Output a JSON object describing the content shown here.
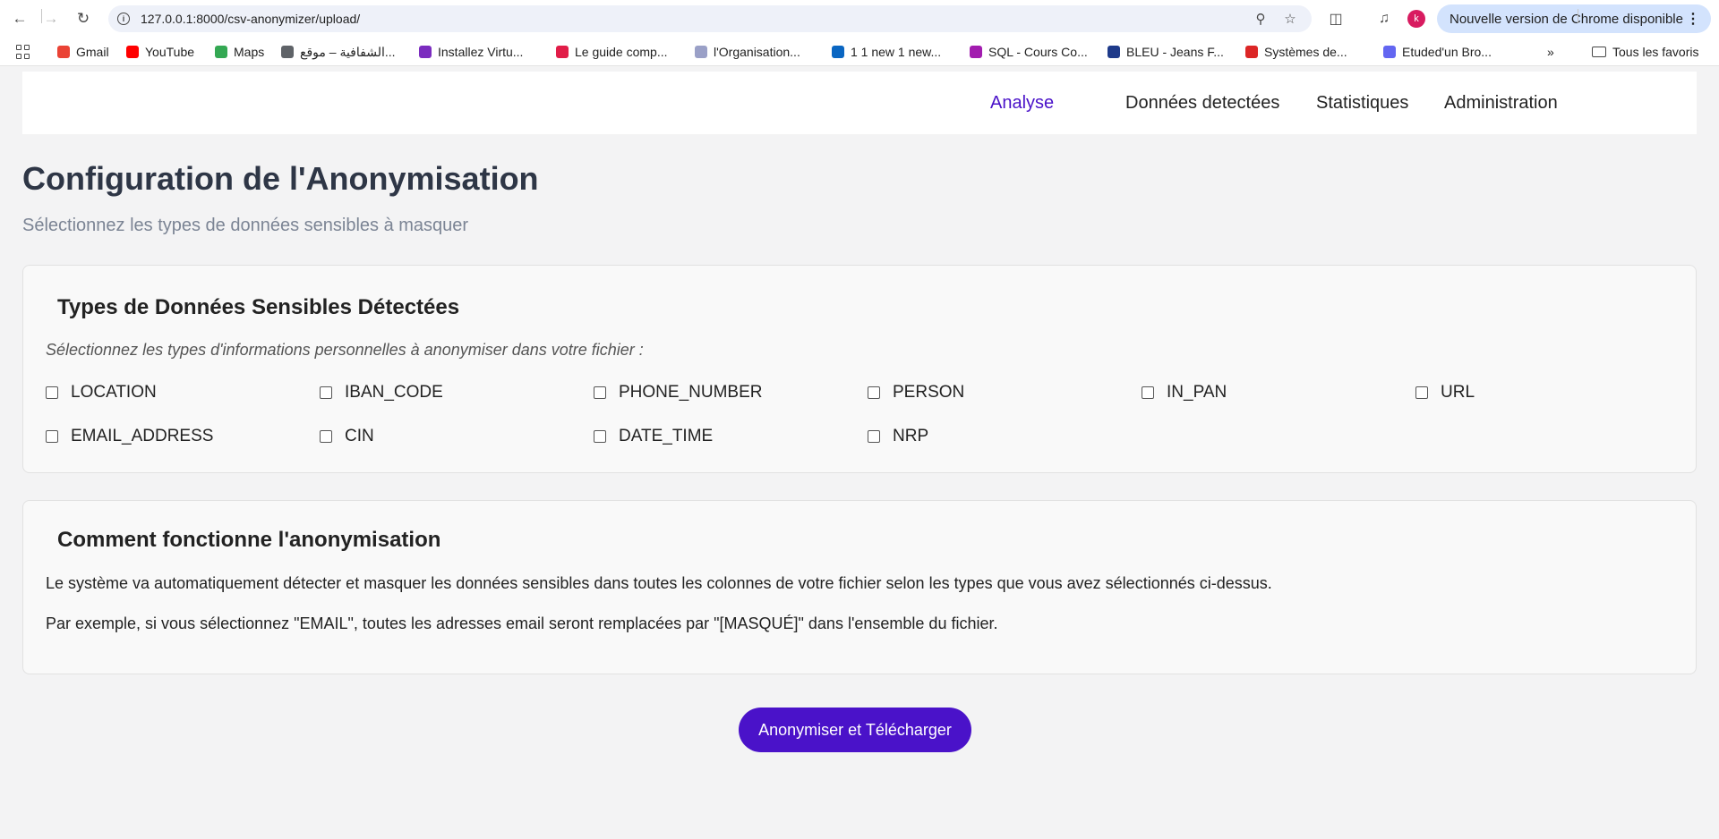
{
  "browser": {
    "url": "127.0.0.1:8000/csv-anonymizer/upload/",
    "update_label": "Nouvelle version de Chrome disponible",
    "profile_initial": "k",
    "bookmarks": [
      {
        "label": "Gmail",
        "icon": "gmail-icon",
        "color": "#ea4335"
      },
      {
        "label": "YouTube",
        "icon": "youtube-icon",
        "color": "#ff0000"
      },
      {
        "label": "Maps",
        "icon": "maps-icon",
        "color": "#34a853"
      },
      {
        "label": "الشفافية – موقع...",
        "icon": "globe-icon",
        "color": "#5f6368"
      },
      {
        "label": "Installez Virtu...",
        "icon": "purple-square-icon",
        "color": "#7b2cbf"
      },
      {
        "label": "Le guide comp...",
        "icon": "red-logo-icon",
        "color": "#e11d48"
      },
      {
        "label": "l'Organisation...",
        "icon": "circle-logo-icon",
        "color": "#9aa0c7"
      },
      {
        "label": "1 1 new 1 new...",
        "icon": "linkedin-icon",
        "color": "#0a66c2"
      },
      {
        "label": "SQL - Cours Co...",
        "icon": "purple-circle-icon",
        "color": "#a21caf"
      },
      {
        "label": "BLEU - Jeans F...",
        "icon": "lcw-icon",
        "color": "#1e3a8a"
      },
      {
        "label": "Systèmes de...",
        "icon": "red-circle-icon",
        "color": "#dc2626"
      },
      {
        "label": "Etuded'un Bro...",
        "icon": "target-icon",
        "color": "#6366f1"
      }
    ],
    "all_bookmarks_label": "Tous les favoris"
  },
  "nav": {
    "items": [
      "Analyse",
      "Données detectées",
      "Statistiques",
      "Administration"
    ],
    "active_index": 0
  },
  "header": {
    "title": "Configuration de l'Anonymisation",
    "subtitle": "Sélectionnez les types de données sensibles à masquer"
  },
  "types_card": {
    "title": "Types de Données Sensibles Détectées",
    "hint": "Sélectionnez les types d'informations personnelles à anonymiser dans votre fichier :",
    "options": [
      {
        "label": "LOCATION",
        "checked": false
      },
      {
        "label": "IBAN_CODE",
        "checked": false
      },
      {
        "label": "PHONE_NUMBER",
        "checked": false
      },
      {
        "label": "PERSON",
        "checked": false
      },
      {
        "label": "IN_PAN",
        "checked": false
      },
      {
        "label": "URL",
        "checked": false
      },
      {
        "label": "EMAIL_ADDRESS",
        "checked": false
      },
      {
        "label": "CIN",
        "checked": false
      },
      {
        "label": "DATE_TIME",
        "checked": false
      },
      {
        "label": "NRP",
        "checked": false
      }
    ]
  },
  "info_card": {
    "title": "Comment fonctionne l'anonymisation",
    "paragraph_1": "Le système va automatiquement détecter et masquer les données sensibles dans toutes les colonnes de votre fichier selon les types que vous avez sélectionnés ci-dessus.",
    "paragraph_2": "Par exemple, si vous sélectionnez \"EMAIL\", toutes les adresses email seront remplacées par \"[MASQUÉ]\" dans l'ensemble du fichier."
  },
  "action": {
    "submit_label": "Anonymiser et Télécharger"
  },
  "colors": {
    "accent": "#4a12c9",
    "page_bg": "#f3f3f4",
    "card_bg": "#f9f9f9"
  }
}
